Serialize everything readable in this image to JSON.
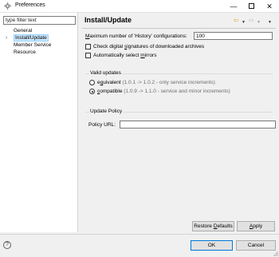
{
  "window": {
    "title": "Preferences",
    "minimize_glyph": "—",
    "close_glyph": "✕"
  },
  "sidebar": {
    "filter_placeholder": "type filter text",
    "items": [
      {
        "label": "General",
        "twisty": "",
        "selected": false
      },
      {
        "label": "Install/Update",
        "twisty": "›",
        "selected": true
      },
      {
        "label": "Member Service",
        "twisty": "",
        "selected": false
      },
      {
        "label": "Resource",
        "twisty": "",
        "selected": false
      }
    ]
  },
  "header": {
    "title": "Install/Update",
    "back_glyph": "⇦",
    "forward_glyph": "⇨",
    "dropdown_glyph": "▼"
  },
  "form": {
    "history_label_pre": "",
    "history_label_mn": "M",
    "history_label_post": "aximum number of 'History' configurations:",
    "history_value": "100",
    "check_signatures_pre": "Check digital ",
    "check_signatures_mn": "s",
    "check_signatures_post": "ignatures of downloaded archives",
    "auto_mirrors_pre": "Automatically select ",
    "auto_mirrors_mn": "m",
    "auto_mirrors_post": "irrors"
  },
  "valid_updates": {
    "title": "Valid updates",
    "equivalent_pre": "e",
    "equivalent_mn": "q",
    "equivalent_post": "uivalent",
    "equivalent_desc": "(1.0.1 -> 1.0.2 - only service increments)",
    "compatible_pre": "",
    "compatible_mn": "c",
    "compatible_post": "ompatible",
    "compatible_desc": "(1.0.9 -> 1.1.0 - service and minor increments)",
    "selected": "compatible"
  },
  "update_policy": {
    "title": "Update Policy",
    "url_label": "Policy URL:",
    "url_value": ""
  },
  "buttons": {
    "restore_pre": "Restore ",
    "restore_mn": "D",
    "restore_post": "efaults",
    "apply_mn": "A",
    "apply_post": "pply",
    "ok": "OK",
    "cancel": "Cancel"
  },
  "help": {
    "glyph": "?"
  },
  "colors": {
    "accent": "#0078d7",
    "selection": "#cce8ff",
    "nav_arrow": "#e39b1d"
  }
}
